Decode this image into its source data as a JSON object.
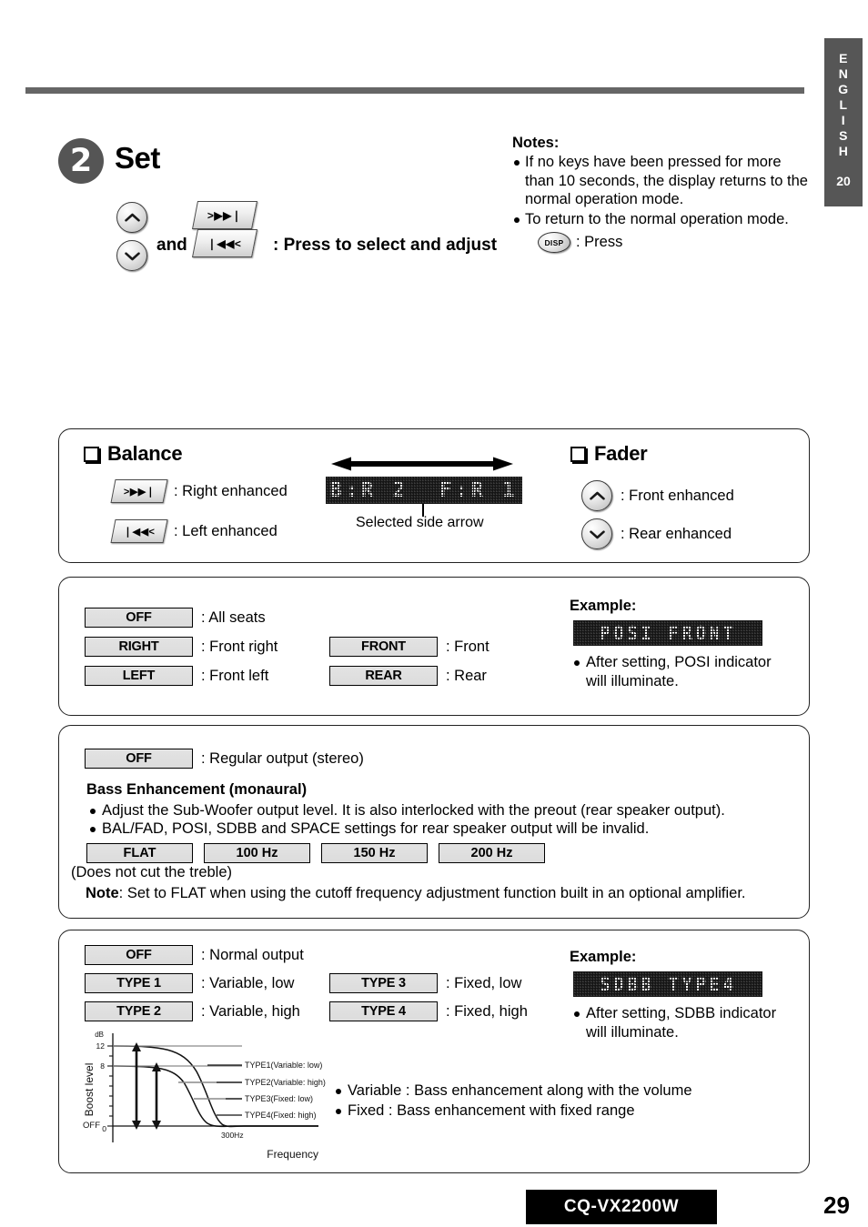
{
  "sidebar": {
    "language_letters": [
      "E",
      "N",
      "G",
      "L",
      "I",
      "S",
      "H"
    ],
    "section_number": "20"
  },
  "step": {
    "number": "2",
    "title": "Set",
    "and_label": "and",
    "instruction": ": Press to select and adjust",
    "key_right_glyph": ">▶▶❘",
    "key_left_glyph": "❘◀◀<"
  },
  "notes": {
    "heading": "Notes:",
    "items": [
      "If no keys have been pressed for more than 10 seconds, the display returns to the normal operation mode.",
      "To return to the normal operation mode."
    ],
    "disp_button_label": "DISP",
    "disp_action": ": Press"
  },
  "balance_panel": {
    "balance_title": "Balance",
    "fader_title": "Fader",
    "balance_items": [
      {
        "label": ": Right enhanced"
      },
      {
        "label": ": Left enhanced"
      }
    ],
    "fader_items": [
      {
        "label": ": Front enhanced"
      },
      {
        "label": ": Rear enhanced"
      }
    ],
    "lcd_text": "B:R 2  F:R 1",
    "selected_side_caption": "Selected side arrow"
  },
  "posi_panel": {
    "left_options": [
      {
        "chip": "OFF",
        "desc": ": All seats"
      },
      {
        "chip": "RIGHT",
        "desc": ": Front right"
      },
      {
        "chip": "LEFT",
        "desc": ": Front left"
      }
    ],
    "right_options": [
      {
        "chip": "FRONT",
        "desc": ": Front"
      },
      {
        "chip": "REAR",
        "desc": ": Rear"
      }
    ],
    "example_heading": "Example:",
    "example_lcd": "POSI FRONT",
    "example_note": "After setting, POSI indicator will illuminate."
  },
  "sdbb_panel": {
    "off_chip": "OFF",
    "off_desc": ": Regular output (stereo)",
    "heading": "Bass Enhancement (monaural)",
    "bullets": [
      "Adjust the Sub-Woofer output level. It is also interlocked with the preout (rear speaker output).",
      "BAL/FAD, POSI, SDBB and SPACE settings for rear speaker output will be invalid."
    ],
    "freq_chips": [
      "FLAT",
      "100 Hz",
      "150 Hz",
      "200 Hz"
    ],
    "treble_note": "(Does not cut the treble)",
    "note_label": "Note",
    "note_text": ": Set to FLAT when using the cutoff frequency adjustment function built in an optional amplifier."
  },
  "type_panel": {
    "left_options": [
      {
        "chip": "OFF",
        "desc": ": Normal output"
      },
      {
        "chip": "TYPE 1",
        "desc": ": Variable, low"
      },
      {
        "chip": "TYPE 2",
        "desc": ": Variable, high"
      }
    ],
    "right_options": [
      {
        "chip": "TYPE 3",
        "desc": ": Fixed, low"
      },
      {
        "chip": "TYPE 4",
        "desc": ": Fixed, high"
      }
    ],
    "example_heading": "Example:",
    "example_lcd": "SDBB TYPE4",
    "example_note": "After setting, SDBB indicator will illuminate.",
    "bullets": [
      "Variable : Bass enhancement along with the volume",
      "Fixed : Bass enhancement with fixed range"
    ]
  },
  "chart_data": {
    "type": "line",
    "title": "",
    "xlabel": "Frequency",
    "ylabel": "Boost level",
    "yunit": "dB",
    "ytick_labels": [
      "12",
      "8",
      "0"
    ],
    "ytick_values": [
      12,
      8,
      0
    ],
    "yoff_label": "OFF",
    "xtick_labels": [
      "300Hz"
    ],
    "ylim": [
      0,
      13.5
    ],
    "grid": false,
    "legend_position": "right-inline",
    "series": [
      {
        "name": "TYPE1(Variable: low)",
        "level_db": 12,
        "style": "curve-low-rolloff",
        "legend_y_db": 6.8
      },
      {
        "name": "TYPE2(Variable: high)",
        "level_db": 8,
        "style": "curve-high-rolloff",
        "legend_y_db": 5.0
      },
      {
        "name": "TYPE3(Fixed: low)",
        "level_db": 12,
        "style": "fixed-low",
        "legend_y_db": 3.3
      },
      {
        "name": "TYPE4(Fixed: high)",
        "level_db": 8,
        "style": "fixed-high",
        "legend_y_db": 1.8
      }
    ],
    "annotations": [
      {
        "type": "double-arrow",
        "from_db": 0,
        "to_db": 12,
        "note": "variable range type1"
      },
      {
        "type": "double-arrow",
        "from_db": 0,
        "to_db": 8,
        "note": "variable range type2"
      }
    ]
  },
  "footer": {
    "model": "CQ-VX2200W",
    "page_number": "29"
  }
}
